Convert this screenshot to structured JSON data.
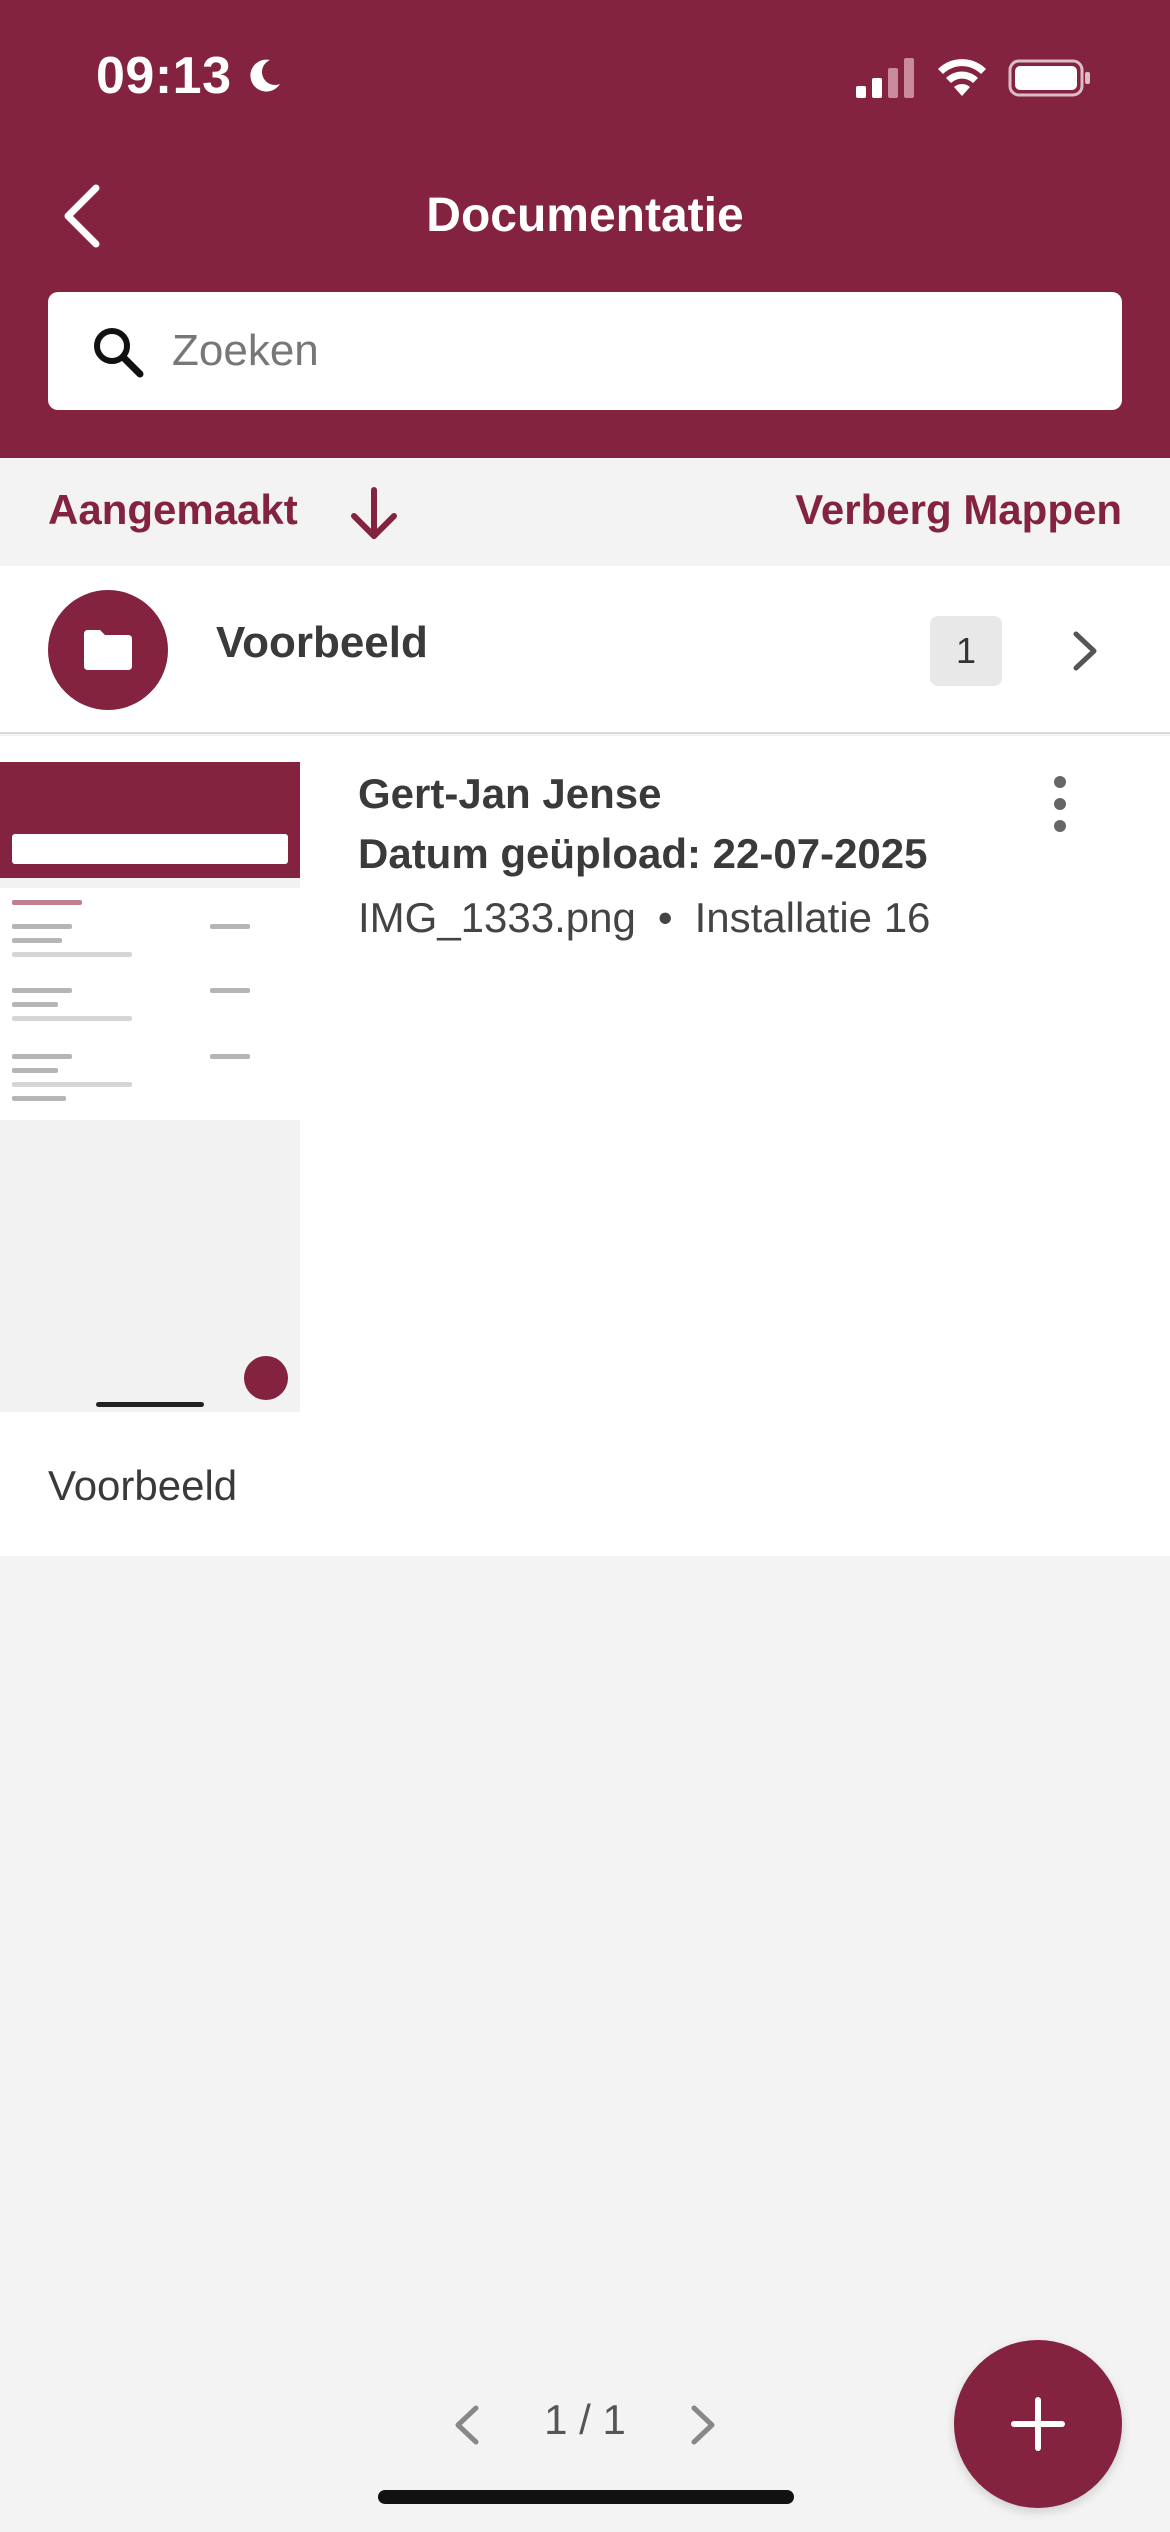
{
  "status_bar": {
    "time": "09:13"
  },
  "header": {
    "title": "Documentatie",
    "search_placeholder": "Zoeken"
  },
  "sort_bar": {
    "sort_label": "Aangemaakt",
    "hide_folders_label": "Verberg Mappen"
  },
  "folders": [
    {
      "name": "Voorbeeld",
      "count": "1"
    }
  ],
  "documents": [
    {
      "author": "Gert-Jan Jense",
      "date_line": "Datum geüpload: 22-07-2025",
      "filename": "IMG_1333.png",
      "separator": "•",
      "installation": "Installatie 16",
      "folder": "Voorbeeld"
    }
  ],
  "pagination": {
    "text": "1 / 1"
  },
  "colors": {
    "brand": "#832340",
    "background": "#f3f3f3"
  },
  "icons": [
    "back-chevron-icon",
    "search-icon",
    "arrow-down-icon",
    "folder-icon",
    "chevron-right-icon",
    "more-vertical-icon",
    "plus-icon"
  ]
}
